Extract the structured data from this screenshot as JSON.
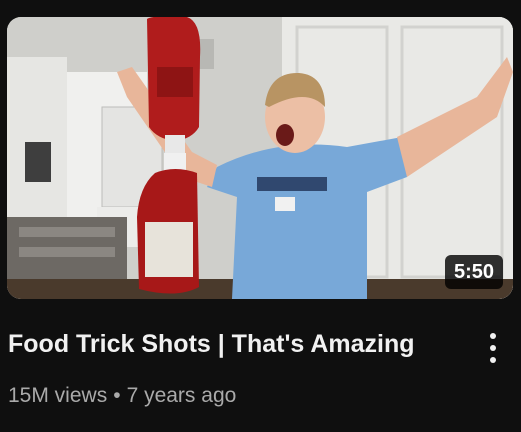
{
  "video": {
    "title": "Food Trick Shots | That's Amazing",
    "duration": "5:50",
    "views": "15M views",
    "separator": "•",
    "age": "7 years ago"
  },
  "icons": {
    "more_actions": "vertical-ellipsis-icon"
  },
  "colors": {
    "background": "#0f0f0f",
    "title": "#f1f1f1",
    "secondary_text": "#aaaaaa",
    "shirt": "#78a8d8",
    "ketchup": "#b01c1c"
  }
}
